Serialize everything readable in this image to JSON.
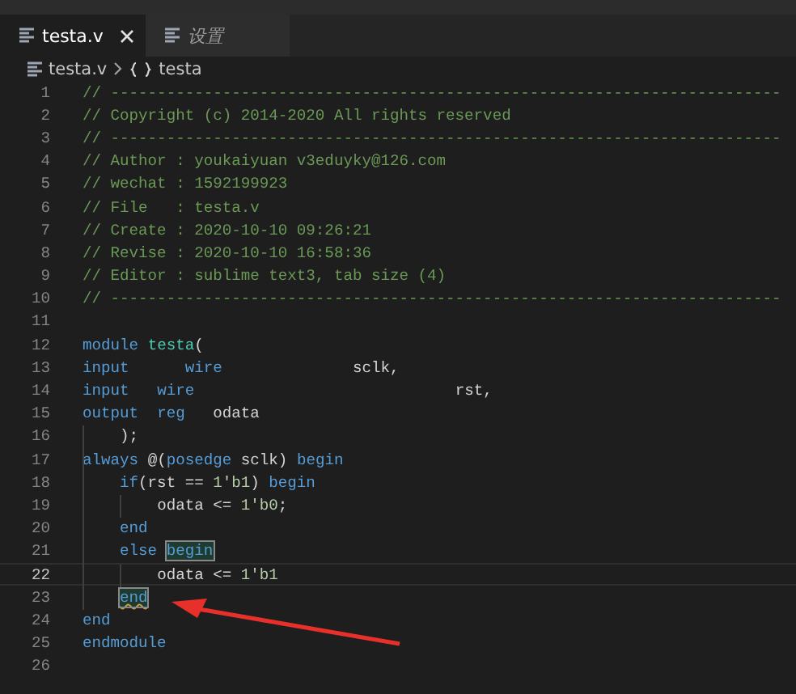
{
  "tabs": [
    {
      "label": "testa.v",
      "selected": true,
      "preview": false,
      "closable": true
    },
    {
      "label": "设置",
      "selected": false,
      "preview": true,
      "closable": false
    }
  ],
  "breadcrumb": {
    "file": "testa.v",
    "symbol": "testa"
  },
  "lines": [
    {
      "number": "1",
      "current": false,
      "tokens": [
        {
          "t": "// ------------------------------------------------------------------------",
          "kind": "comment"
        }
      ]
    },
    {
      "number": "2",
      "current": false,
      "tokens": [
        {
          "t": "// Copyright (c) 2014-2020 All rights reserved",
          "kind": "comment"
        }
      ]
    },
    {
      "number": "3",
      "current": false,
      "tokens": [
        {
          "t": "// ------------------------------------------------------------------------",
          "kind": "comment"
        }
      ]
    },
    {
      "number": "4",
      "current": false,
      "tokens": [
        {
          "t": "// Author : youkaiyuan v3eduyky@126.com",
          "kind": "comment"
        }
      ]
    },
    {
      "number": "5",
      "current": false,
      "tokens": [
        {
          "t": "// wechat : 1592199923",
          "kind": "comment"
        }
      ]
    },
    {
      "number": "6",
      "current": false,
      "tokens": [
        {
          "t": "// File   : testa.v",
          "kind": "comment"
        }
      ]
    },
    {
      "number": "7",
      "current": false,
      "tokens": [
        {
          "t": "// Create : 2020-10-10 09:26:21",
          "kind": "comment"
        }
      ]
    },
    {
      "number": "8",
      "current": false,
      "tokens": [
        {
          "t": "// Revise : 2020-10-10 16:58:36",
          "kind": "comment"
        }
      ]
    },
    {
      "number": "9",
      "current": false,
      "tokens": [
        {
          "t": "// Editor : sublime text3, tab size (4)",
          "kind": "comment"
        }
      ]
    },
    {
      "number": "10",
      "current": false,
      "tokens": [
        {
          "t": "// ------------------------------------------------------------------------",
          "kind": "comment"
        }
      ]
    },
    {
      "number": "11",
      "current": false
    },
    {
      "number": "12",
      "current": false,
      "tokens": [
        {
          "t": "module ",
          "kind": "keyword"
        },
        {
          "t": "testa",
          "kind": "name"
        },
        {
          "t": "(",
          "kind": "plain"
        }
      ]
    },
    {
      "number": "13",
      "current": false,
      "tokens": [
        {
          "t": "input",
          "kind": "keyword"
        },
        {
          "t": "      wire",
          "kind": "keyword"
        },
        {
          "t": "              sclk,",
          "kind": "plain"
        }
      ]
    },
    {
      "number": "14",
      "current": false,
      "tokens": [
        {
          "t": "input",
          "kind": "keyword"
        },
        {
          "t": "   wire",
          "kind": "keyword"
        },
        {
          "t": "                            rst,",
          "kind": "plain"
        }
      ]
    },
    {
      "number": "15",
      "current": false,
      "tokens": [
        {
          "t": "output",
          "kind": "keyword"
        },
        {
          "t": "  reg",
          "kind": "keyword"
        },
        {
          "t": "   odata",
          "kind": "plain"
        }
      ]
    },
    {
      "number": "16",
      "current": false,
      "tokens": [
        {
          "t": "    );",
          "kind": "plain"
        }
      ]
    },
    {
      "number": "17",
      "current": false,
      "tokens": [
        {
          "t": "always",
          "kind": "keyword"
        },
        {
          "t": " @(",
          "kind": "plain"
        },
        {
          "t": "posedge",
          "kind": "keyword"
        },
        {
          "t": " sclk) ",
          "kind": "plain"
        },
        {
          "t": "begin",
          "kind": "keyword"
        }
      ]
    },
    {
      "number": "18",
      "current": false,
      "tokens": [
        {
          "t": "    if",
          "kind": "keyword"
        },
        {
          "t": "(rst == ",
          "kind": "plain"
        },
        {
          "t": "1'b1",
          "kind": "number"
        },
        {
          "t": ") ",
          "kind": "plain"
        },
        {
          "t": "begin",
          "kind": "keyword"
        }
      ]
    },
    {
      "number": "19",
      "current": false,
      "tokens": [
        {
          "t": "        odata <= ",
          "kind": "plain"
        },
        {
          "t": "1'b0",
          "kind": "number"
        },
        {
          "t": ";",
          "kind": "plain"
        }
      ]
    },
    {
      "number": "20",
      "current": false,
      "tokens": [
        {
          "t": "    end",
          "kind": "keyword"
        }
      ]
    },
    {
      "number": "21",
      "current": false,
      "tokens": [
        {
          "t": "    else ",
          "kind": "keyword"
        },
        {
          "t": "begin",
          "kind": "keyword",
          "bracket_match": true,
          "warning": false
        }
      ]
    },
    {
      "number": "22",
      "current": true,
      "tokens": [
        {
          "t": "        odata <= ",
          "kind": "plain"
        },
        {
          "t": "1'b1",
          "kind": "number"
        }
      ]
    },
    {
      "number": "23",
      "current": false,
      "tokens": [
        {
          "t": "    end",
          "kind": "keyword",
          "bracket_match": true,
          "warning": true
        }
      ]
    },
    {
      "number": "24",
      "current": false,
      "tokens": [
        {
          "t": "end",
          "kind": "keyword"
        }
      ]
    },
    {
      "number": "25",
      "current": false,
      "tokens": [
        {
          "t": "endmodule",
          "kind": "keyword"
        }
      ]
    },
    {
      "number": "26",
      "current": false
    }
  ]
}
